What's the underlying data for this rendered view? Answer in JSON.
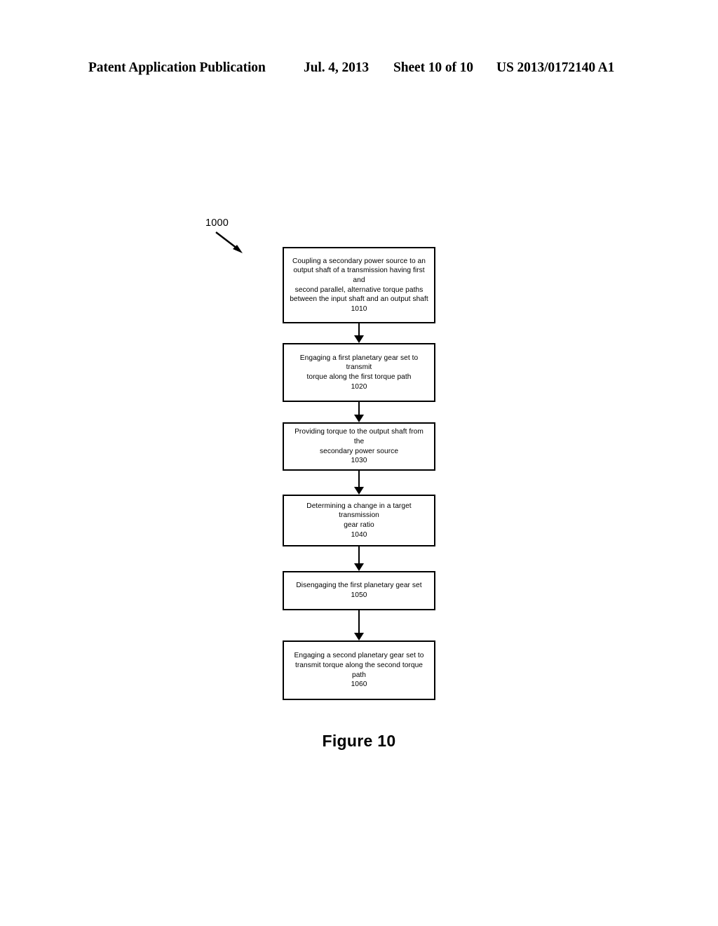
{
  "header": {
    "publication": "Patent Application Publication",
    "date": "Jul. 4, 2013",
    "sheet": "Sheet 10 of 10",
    "document_number": "US 2013/0172140 A1"
  },
  "figure": {
    "reference_label": "1000",
    "caption": "Figure 10",
    "type": "flowchart",
    "steps": [
      {
        "id": "1010",
        "text": "Coupling a secondary power source to an\noutput shaft of a transmission having first and\nsecond parallel, alternative torque paths\nbetween the input shaft and an output shaft\n1010"
      },
      {
        "id": "1020",
        "text": "Engaging a first planetary gear set to transmit\ntorque along the first torque path\n1020"
      },
      {
        "id": "1030",
        "text": "Providing torque to the output shaft from the\nsecondary power source\n1030"
      },
      {
        "id": "1040",
        "text": "Determining a change in a target transmission\ngear ratio\n1040"
      },
      {
        "id": "1050",
        "text": "Disengaging the first planetary gear set\n1050"
      },
      {
        "id": "1060",
        "text": "Engaging a second planetary gear set to\ntransmit torque along the second torque path\n1060"
      }
    ]
  },
  "colors": {
    "ink": "#000000",
    "paper": "#ffffff"
  }
}
